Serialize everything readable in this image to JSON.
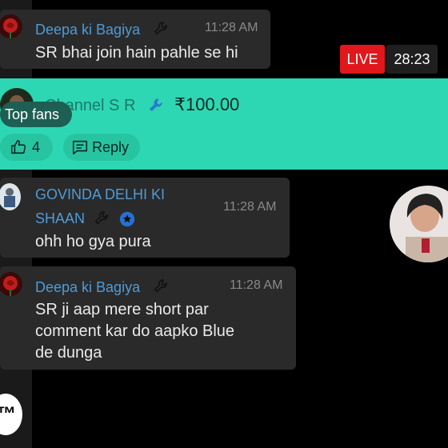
{
  "stream": {
    "live_label": "LIVE",
    "elapsed": "28:23"
  },
  "comments": [
    {
      "author": "Deepa ki Bagiya",
      "time": "11:28 AM",
      "lines": [
        "SR bhai join hain pahle se hi"
      ]
    },
    {
      "author_lines": [
        "GOVINDA DELHI KI",
        "SHAAN"
      ],
      "time": "11:28 AM",
      "lines": [
        "ohh ho gya pura"
      ]
    },
    {
      "author": "Deepa ki Bagiya",
      "time": "11:28 AM",
      "lines": [
        "SR ji aap mere short par",
        "comment kar do aapko Blue",
        "de dunga"
      ]
    }
  ],
  "super_chat": {
    "author": "Channel S R",
    "amount": "₹100.00",
    "badge": "Top fans",
    "like_count": "4",
    "reply_label": "Reply",
    "color": "#2ed7b3"
  },
  "icons": {
    "moderator": "wrench-icon",
    "verified": "star-badge-icon",
    "like": "thumbs-up-icon",
    "reply": "reply-icon"
  },
  "colors": {
    "author": "#4e9bd9",
    "live": "#e0171b",
    "bubble": "#2a2a2a"
  }
}
